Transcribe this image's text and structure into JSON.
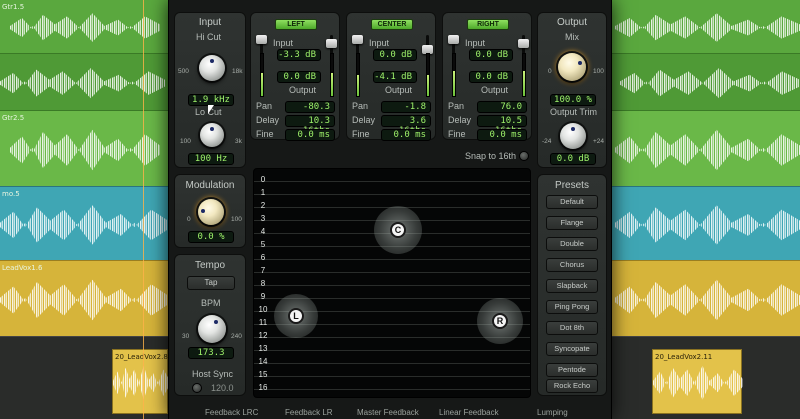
{
  "tracks": [
    {
      "label": "Gtr1.5"
    },
    {
      "label": "Gtr2.5"
    },
    {
      "label": "mo.5"
    },
    {
      "label": "LeadVox1.6"
    },
    {
      "label": "20_LeadVox2.8"
    },
    {
      "label": "20_LeadVox2.11"
    }
  ],
  "input": {
    "title": "Input",
    "hicut_label": "Hi Cut",
    "hicut_min": "500",
    "hicut_max": "18k",
    "hicut_value": "1.9 kHz",
    "locut_label": "Lo Cut",
    "locut_min": "100",
    "locut_max": "3k",
    "locut_value": "100 Hz"
  },
  "channels": [
    {
      "name": "LEFT",
      "input_label": "Input",
      "input_value": "-3.3 dB",
      "output_value": "0.0 dB",
      "output_label": "Output",
      "pan_label": "Pan",
      "pan_value": "-80.3",
      "delay_label": "Delay",
      "delay_value": "10.3 16ths",
      "fine_label": "Fine",
      "fine_value": "0.0 ms",
      "meter_level": 0.55
    },
    {
      "name": "CENTER",
      "input_label": "Input",
      "input_value": "0.0 dB",
      "output_value": "-4.1 dB",
      "output_label": "Output",
      "pan_label": "Pan",
      "pan_value": "-1.8",
      "delay_label": "Delay",
      "delay_value": "3.6 16ths",
      "fine_label": "Fine",
      "fine_value": "0.0 ms",
      "meter_level": 0.5
    },
    {
      "name": "RIGHT",
      "input_label": "Input",
      "input_value": "0.0 dB",
      "output_value": "0.0 dB",
      "output_label": "Output",
      "pan_label": "Pan",
      "pan_value": "76.0",
      "delay_label": "Delay",
      "delay_value": "10.5 16ths",
      "fine_label": "Fine",
      "fine_value": "0.0 ms",
      "meter_level": 0.6
    }
  ],
  "snap_label": "Snap to 16th",
  "output": {
    "title": "Output",
    "mix_label": "Mix",
    "mix_min": "0",
    "mix_max": "100",
    "mix_value": "100.0 %",
    "trim_label": "Output Trim",
    "trim_min": "-24",
    "trim_max": "+24",
    "trim_value": "0.0 dB"
  },
  "modulation": {
    "title": "Modulation",
    "min": "0",
    "max": "100",
    "value": "0.0 %"
  },
  "tempo": {
    "title": "Tempo",
    "tap_label": "Tap",
    "bpm_label": "BPM",
    "bpm_min": "30",
    "bpm_max": "240",
    "bpm_value": "173.3",
    "host_sync_label": "Host Sync",
    "host_sync_value": "120.0"
  },
  "grid": {
    "row_numbers": [
      "0",
      "1",
      "2",
      "3",
      "4",
      "5",
      "6",
      "7",
      "8",
      "9",
      "10",
      "11",
      "12",
      "13",
      "14",
      "15",
      "16"
    ],
    "nodes": [
      {
        "label": "C"
      },
      {
        "label": "L"
      },
      {
        "label": "R"
      }
    ]
  },
  "presets": {
    "title": "Presets",
    "items": [
      "Default",
      "Flange",
      "Double",
      "Chorus",
      "Slapback",
      "Ping Pong",
      "Dot 8th",
      "Syncopate",
      "Pentode",
      "Rock Echo"
    ]
  },
  "bottom_tabs": [
    "Feedback LRC",
    "Feedback LR",
    "Master Feedback",
    "Linear Feedback",
    "Lumping"
  ]
}
